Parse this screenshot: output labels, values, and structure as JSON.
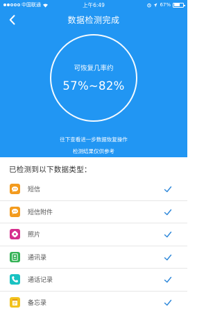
{
  "status_bar": {
    "carrier": "中国联通",
    "time": "上午6:49",
    "battery_text": "67%",
    "battery_level": 0.67
  },
  "nav": {
    "title": "数据检测完成"
  },
  "result": {
    "label": "可恢复几率约",
    "value": "57%~82%"
  },
  "hints": {
    "line1": "往下查看进一步数据恢复操作",
    "line2": "检测结果仅供参考"
  },
  "section_title": "已检测到以下数据类型：",
  "items": [
    {
      "label": "短信",
      "icon": "chat-bubble-icon",
      "color": "#f39b1e",
      "checked": true
    },
    {
      "label": "短信附件",
      "icon": "chat-bubble-icon",
      "color": "#f39b1e",
      "checked": true
    },
    {
      "label": "照片",
      "icon": "flower-icon",
      "color": "#d62f8d",
      "checked": true
    },
    {
      "label": "通讯录",
      "icon": "contact-card-icon",
      "color": "#34b255",
      "checked": true
    },
    {
      "label": "通话记录",
      "icon": "phone-icon",
      "color": "#19c2c2",
      "checked": true
    },
    {
      "label": "备忘录",
      "icon": "notepad-icon",
      "color": "#f2c21d",
      "checked": true
    }
  ],
  "colors": {
    "primary": "#2196f3",
    "check": "#2b86d9"
  }
}
